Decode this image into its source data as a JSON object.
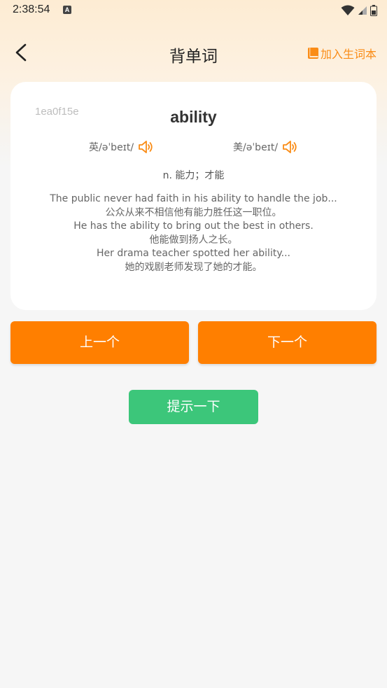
{
  "status_bar": {
    "time": "2:38:54",
    "notification_icon": "a-icon",
    "icons": [
      "wifi-icon",
      "signal-icon",
      "battery-icon"
    ]
  },
  "nav": {
    "title": "背单词",
    "back_icon": "chevron-left-icon",
    "add_vocab_label": "加入生词本",
    "add_vocab_icon": "book-icon"
  },
  "card": {
    "word_id": "1ea0f15e",
    "word": "ability",
    "phonetics": {
      "uk": "英/əˈbeɪt/",
      "us": "美/əˈbeɪt/"
    },
    "meaning": "n. 能力；才能",
    "examples": [
      "The public never had faith in his ability to handle the job...",
      "公众从来不相信他有能力胜任这一职位。",
      "He has the ability to bring out the best in others.",
      "他能做到扬人之长。",
      "Her drama teacher spotted her ability...",
      "她的戏剧老师发现了她的才能。"
    ]
  },
  "buttons": {
    "prev": "上一个",
    "next": "下一个",
    "hint": "提示一下"
  },
  "colors": {
    "accent_orange": "#ff7f00",
    "link_orange": "#fa8c16",
    "hint_green": "#3cc67a",
    "header_gradient_top": "#fdecd3",
    "background": "#f6f6f6"
  }
}
